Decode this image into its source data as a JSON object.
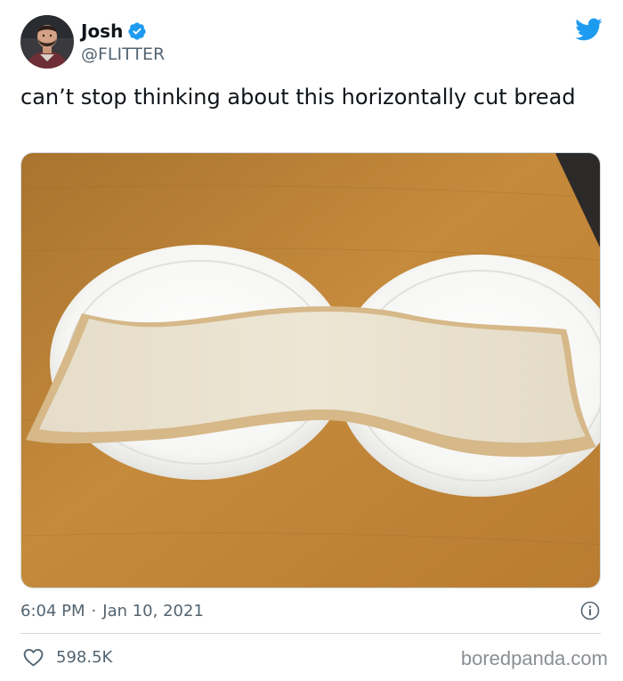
{
  "author": {
    "name": "Josh",
    "handle": "@FLITTER"
  },
  "tweet": {
    "text": "can’t stop thinking about this horizontally cut bread",
    "time": "6:04 PM",
    "separator": "·",
    "date": "Jan 10, 2021"
  },
  "engagement": {
    "likes": "598.5K"
  },
  "watermark": "boredpanda.com",
  "icons": {
    "verified": "verified-badge-icon",
    "logo": "twitter-bird-icon",
    "info": "info-icon",
    "like": "heart-icon"
  },
  "colors": {
    "twitter_blue": "#1d9bf0",
    "secondary_text": "#536471",
    "primary_text": "#0f1419",
    "divider": "#cfd9de"
  }
}
